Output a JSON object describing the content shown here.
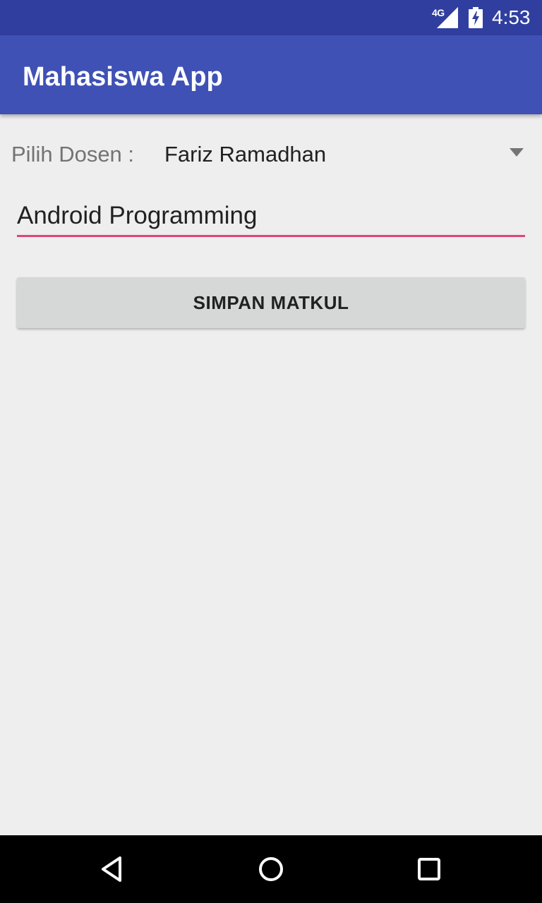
{
  "status_bar": {
    "network": "4G",
    "time": "4:53",
    "icons": [
      "signal-icon",
      "battery-charging-icon"
    ]
  },
  "app_bar": {
    "title": "Mahasiswa App",
    "color": "#3F51B5",
    "status_color": "#303F9F"
  },
  "form": {
    "dosen_label": "Pilih Dosen :",
    "dosen_selected": "Fariz Ramadhan",
    "matkul_value": "Android Programming",
    "accent_color": "#E0457B",
    "save_label": "SIMPAN MATKUL"
  },
  "nav_bar": {
    "icons": [
      "back-icon",
      "home-icon",
      "recents-icon"
    ]
  }
}
